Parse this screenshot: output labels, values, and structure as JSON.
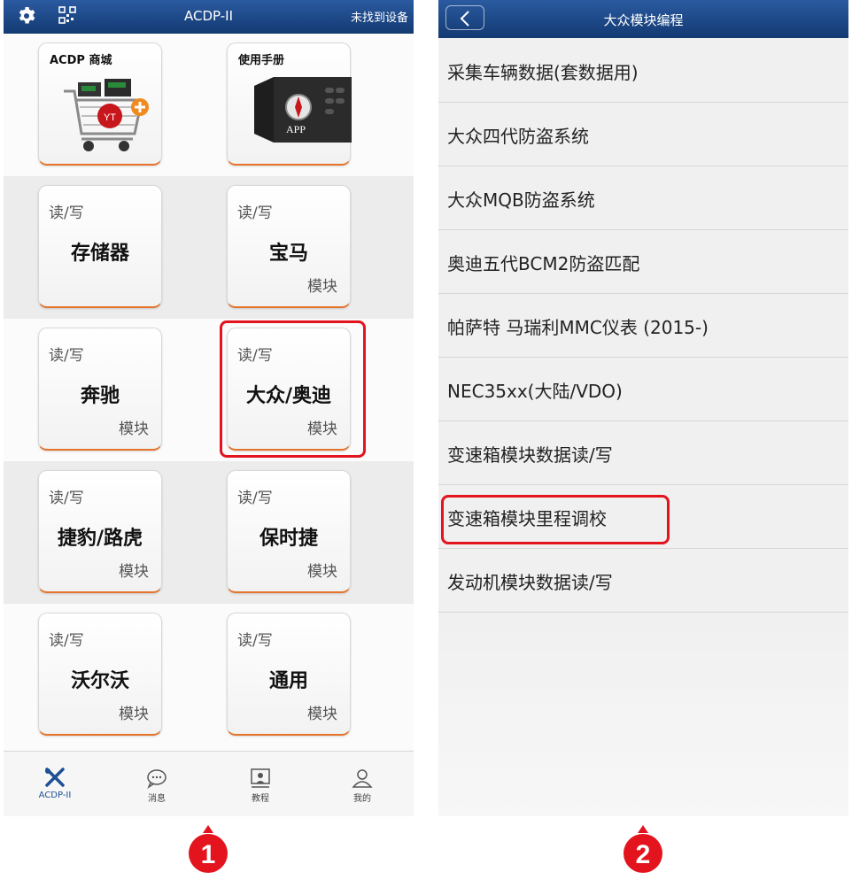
{
  "screen1": {
    "header": {
      "title": "ACDP-II",
      "status": "未找到设备"
    },
    "cards": [
      {
        "title": "ACDP 商城"
      },
      {
        "title": "使用手册",
        "device_text": "APP"
      },
      {
        "rw": "读/写",
        "name": "存储器",
        "module": ""
      },
      {
        "rw": "读/写",
        "name": "宝马",
        "module": "模块"
      },
      {
        "rw": "读/写",
        "name": "奔驰",
        "module": "模块"
      },
      {
        "rw": "读/写",
        "name": "大众/奥迪",
        "module": "模块"
      },
      {
        "rw": "读/写",
        "name": "捷豹/路虎",
        "module": "模块"
      },
      {
        "rw": "读/写",
        "name": "保时捷",
        "module": "模块"
      },
      {
        "rw": "读/写",
        "name": "沃尔沃",
        "module": "模块"
      },
      {
        "rw": "读/写",
        "name": "通用",
        "module": "模块"
      }
    ],
    "tabs": [
      {
        "label": "ACDP-II",
        "icon": "tools-icon"
      },
      {
        "label": "消息",
        "icon": "chat-icon"
      },
      {
        "label": "教程",
        "icon": "tutorial-icon"
      },
      {
        "label": "我的",
        "icon": "user-icon"
      }
    ]
  },
  "screen2": {
    "header": {
      "title": "大众模块编程"
    },
    "items": [
      "采集车辆数据(套数据用)",
      "大众四代防盗系统",
      "大众MQB防盗系统",
      "奥迪五代BCM2防盗匹配",
      "帕萨特 马瑞利MMC仪表 (2015-)",
      "NEC35xx(大陆/VDO)",
      "变速箱模块数据读/写",
      "变速箱模块里程调校",
      "发动机模块数据读/写"
    ]
  },
  "steps": [
    "1",
    "2"
  ],
  "colors": {
    "header": "#1d4a8a",
    "accent_orange": "#e5732a",
    "highlight_red": "#e3141d"
  }
}
